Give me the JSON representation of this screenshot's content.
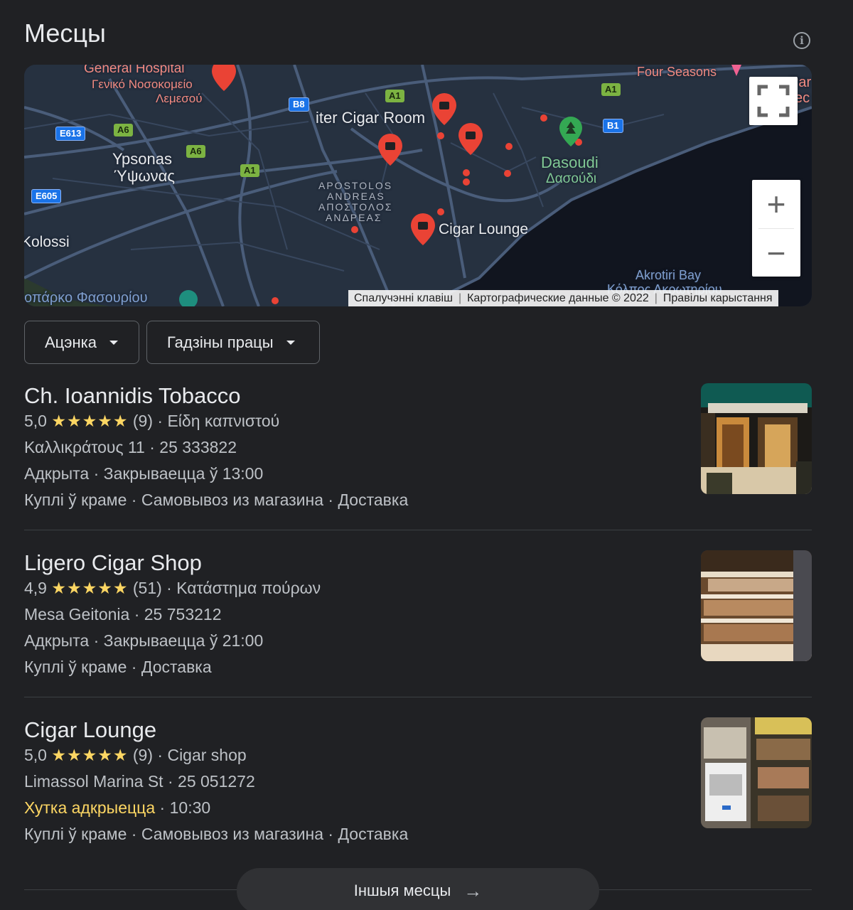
{
  "header": {
    "title": "Месцы",
    "info_icon": "info-icon"
  },
  "map": {
    "labels": {
      "general_hospital": "General Hospital",
      "general_hospital_gr1": "Γενικό Νοσοκομείο",
      "general_hospital_gr2": "Λεμεσού",
      "four_seasons": "Four Seasons",
      "cigar_room": "iter Cigar Room",
      "ypsonas": "Ypsonas",
      "ypsonas_gr": "Ύψωνας",
      "apostolos1": "APOSTOLOS",
      "apostolos2": "ANDREAS",
      "apostolos3": "ΑΠΟΣΤΟΛΟΣ",
      "apostolos4": "ΑΝΔΡΕΑΣ",
      "dasoudi": "Dasoudi",
      "dasoudi_gr": "Δασούδι",
      "cigar_lounge": "Cigar Lounge",
      "kolossi": "Kolossi",
      "akrotiri_bay": "Akrotiri Bay",
      "akrotiri_bay_gr": "Κόλπος Ακρωτηρίου",
      "fasouri": "οπάρκο Φασουρίου",
      "partial_right1": "Par",
      "partial_right2": "ec"
    },
    "roads": {
      "e613": "E613",
      "a6_1": "A6",
      "a6_2": "A6",
      "a1_1": "A1",
      "a1_2": "A1",
      "a1_3": "A1",
      "b8": "B8",
      "b1": "B1",
      "e605": "E605"
    },
    "controls": {
      "zoom_in": "+",
      "zoom_out": "−"
    },
    "attribution": {
      "shortcuts": "Спалучэнні клавіш",
      "map_data": "Картографические данные © 2022",
      "terms": "Правілы карыстання"
    }
  },
  "filters": {
    "rating": "Ацэнка",
    "hours": "Гадзіны працы"
  },
  "places": [
    {
      "name": "Ch. Ioannidis Tobacco",
      "rating": "5,0",
      "stars": "★★★★★",
      "reviews": "(9)",
      "category": "Είδη καπνιστού",
      "address": "Καλλικράτους 11",
      "phone": "25 333822",
      "status": "Адкрыта",
      "hours": "Закрываецца ў 13:00",
      "service1": "Куплі ў краме",
      "service2": "Самовывоз из магазина",
      "service3": "Доставка"
    },
    {
      "name": "Ligero Cigar Shop",
      "rating": "4,9",
      "stars": "★★★★★",
      "reviews": "(51)",
      "category": "Κατάστημα πούρων",
      "address": "Mesa Geitonia",
      "phone": "25 753212",
      "status": "Адкрыта",
      "hours": "Закрываецца ў 21:00",
      "service1": "Куплі ў краме",
      "service2": "Доставка"
    },
    {
      "name": "Cigar Lounge",
      "rating": "5,0",
      "stars": "★★★★★",
      "reviews": "(9)",
      "category": "Cigar shop",
      "address": "Limassol Marina St",
      "phone": "25 051272",
      "status": "Хутка адкрыецца",
      "hours": "10:30",
      "service1": "Куплі ў краме",
      "service2": "Самовывоз из магазина",
      "service3": "Доставка"
    }
  ],
  "more_button": {
    "label": "Іншыя месцы",
    "icon": "arrow-right-icon"
  },
  "colors": {
    "background": "#202124",
    "star": "#fdd663",
    "opening_soon": "#fdd663",
    "pin": "#ea4335"
  }
}
